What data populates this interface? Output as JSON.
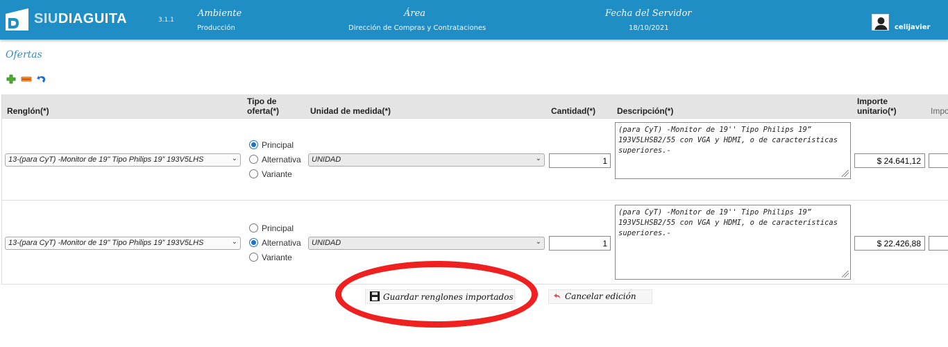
{
  "header": {
    "brand_siu": "SIU",
    "brand_diaguita": "DIAGUITA",
    "version": "3.1.1",
    "ambiente_label": "Ambiente",
    "ambiente_value": "Producción",
    "area_label": "Área",
    "area_value": "Dirección de Compras y Contrataciones",
    "fecha_label": "Fecha del Servidor",
    "fecha_value": "18/10/2021",
    "username": "celijavier",
    "brand_color": "#1f8ec4"
  },
  "page": {
    "title": "Ofertas"
  },
  "toolbar": {
    "icons": [
      "add-icon",
      "remove-icon",
      "undo-icon"
    ]
  },
  "table": {
    "headers": {
      "renglon": "Renglón(*)",
      "tipo_line1": "Tipo de",
      "tipo_line2": "oferta(*)",
      "unidad": "Unidad de medida(*)",
      "cantidad": "Cantidad(*)",
      "descripcion": "Descripción(*)",
      "importe_line1": "Importe",
      "importe_line2": "unitario(*)",
      "extra": "Impo"
    },
    "rows": [
      {
        "renglon": "13-(para CyT) -Monitor de 19\" Tipo Philips 19” 193V5LHS",
        "tipo_options": [
          "Principal",
          "Alternativa",
          "Variante"
        ],
        "tipo_selected": "Principal",
        "unidad": "UNIDAD",
        "cantidad": "1",
        "descripcion": "(para CyT) -Monitor de 19'' Tipo Philips 19” 193V5LHSB2/55 con VGA y HDMI, o de características superiores.-",
        "importe": "$ 24.641,12"
      },
      {
        "renglon": "13-(para CyT) -Monitor de 19\" Tipo Philips 19” 193V5LHS",
        "tipo_options": [
          "Principal",
          "Alternativa",
          "Variante"
        ],
        "tipo_selected": "Alternativa",
        "unidad": "UNIDAD",
        "cantidad": "1",
        "descripcion": "(para CyT) -Monitor de 19'' Tipo Philips 19” 193V5LHSB2/55 con VGA y HDMI, o de características superiores.-",
        "importe": "$ 22.426,88"
      }
    ]
  },
  "actions": {
    "save_label": "Guardar renglones importados",
    "cancel_label": "Cancelar edición",
    "highlight_color": "#ef2020"
  }
}
